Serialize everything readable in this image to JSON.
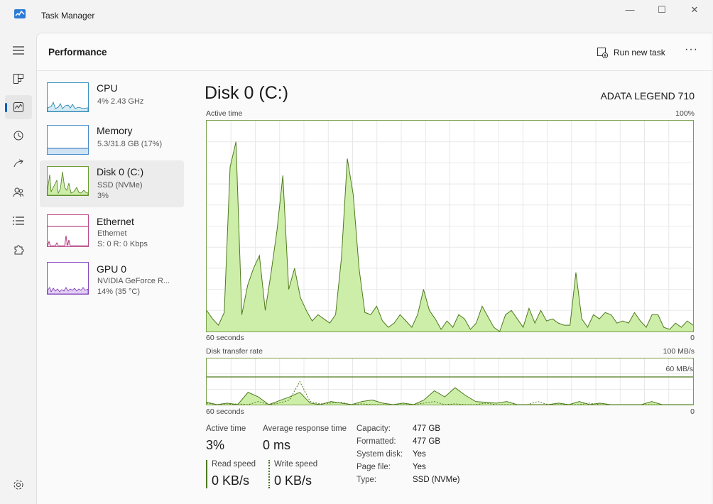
{
  "window": {
    "title": "Task Manager",
    "controls": {
      "minimize": "—",
      "maximize": "☐",
      "close": "✕"
    }
  },
  "header": {
    "title": "Performance",
    "run_new_task": "Run new task",
    "more": "···"
  },
  "sidebar": {
    "items": [
      {
        "name": "CPU",
        "line1": "4%  2.43 GHz",
        "line2": "",
        "icon": "cpu-thumbnail"
      },
      {
        "name": "Memory",
        "line1": "5.3/31.8 GB (17%)",
        "line2": "",
        "icon": "memory-thumbnail"
      },
      {
        "name": "Disk 0 (C:)",
        "line1": "SSD (NVMe)",
        "line2": "3%",
        "icon": "disk-thumbnail",
        "selected": true
      },
      {
        "name": "Ethernet",
        "line1": "Ethernet",
        "line2": "S: 0  R: 0 Kbps",
        "icon": "ethernet-thumbnail"
      },
      {
        "name": "GPU 0",
        "line1": "NVIDIA GeForce R...",
        "line2": "14% (35 °C)",
        "icon": "gpu-thumbnail"
      }
    ]
  },
  "disk": {
    "title": "Disk 0 (C:)",
    "model": "ADATA LEGEND 710",
    "active_time_graph": {
      "label": "Active time",
      "max_label": "100%",
      "x_left": "60 seconds",
      "x_right": "0",
      "values": [
        10,
        6,
        3,
        9,
        78,
        90,
        8,
        22,
        30,
        36,
        10,
        28,
        48,
        74,
        20,
        30,
        16,
        10,
        5,
        8,
        6,
        4,
        8,
        35,
        82,
        65,
        30,
        9,
        8,
        12,
        5,
        2,
        4,
        8,
        5,
        2,
        8,
        20,
        10,
        6,
        1,
        5,
        2,
        8,
        6,
        1,
        4,
        12,
        7,
        2,
        0,
        8,
        10,
        6,
        2,
        11,
        4,
        10,
        5,
        6,
        4,
        3,
        3,
        28,
        6,
        2,
        8,
        6,
        9,
        8,
        4,
        5,
        4,
        9,
        5,
        2,
        8,
        8,
        2,
        1,
        4,
        2,
        5,
        3
      ]
    },
    "transfer_graph": {
      "label": "Disk transfer rate",
      "max_label": "100 MB/s",
      "mid_label": "60 MB/s",
      "x_left": "60 seconds",
      "x_right": "0",
      "read_values": [
        3,
        0,
        2,
        0,
        16,
        10,
        0,
        5,
        10,
        16,
        2,
        0,
        4,
        2,
        0,
        4,
        6,
        2,
        0,
        2,
        0,
        6,
        18,
        10,
        22,
        12,
        4,
        3,
        2,
        4,
        0,
        0,
        0,
        0,
        2,
        0,
        4,
        0,
        2,
        0,
        0,
        0,
        0,
        4,
        0,
        0,
        0,
        0
      ],
      "write_values": [
        2,
        0,
        0,
        1,
        0,
        4,
        0,
        2,
        6,
        30,
        4,
        1,
        2,
        3,
        0,
        1,
        0,
        0,
        0,
        0,
        0,
        2,
        4,
        0,
        1,
        0,
        0,
        2,
        0,
        0,
        0,
        0,
        4,
        0,
        0,
        0,
        0,
        2,
        0,
        0,
        0,
        0,
        0,
        0,
        0,
        0,
        0,
        0
      ]
    },
    "stats": {
      "active_time_label": "Active time",
      "active_time_value": "3%",
      "avg_response_label": "Average response time",
      "avg_response_value": "0 ms",
      "read_speed_label": "Read speed",
      "read_speed_value": "0 KB/s",
      "write_speed_label": "Write speed",
      "write_speed_value": "0 KB/s"
    },
    "properties": [
      {
        "key": "Capacity:",
        "value": "477 GB"
      },
      {
        "key": "Formatted:",
        "value": "477 GB"
      },
      {
        "key": "System disk:",
        "value": "Yes"
      },
      {
        "key": "Page file:",
        "value": "Yes"
      },
      {
        "key": "Type:",
        "value": "SSD (NVMe)"
      }
    ]
  },
  "colors": {
    "disk_line": "#4e7a1e",
    "disk_fill": "#cdeea8",
    "grid": "#e8e8e8",
    "accent": "#005fb8"
  }
}
